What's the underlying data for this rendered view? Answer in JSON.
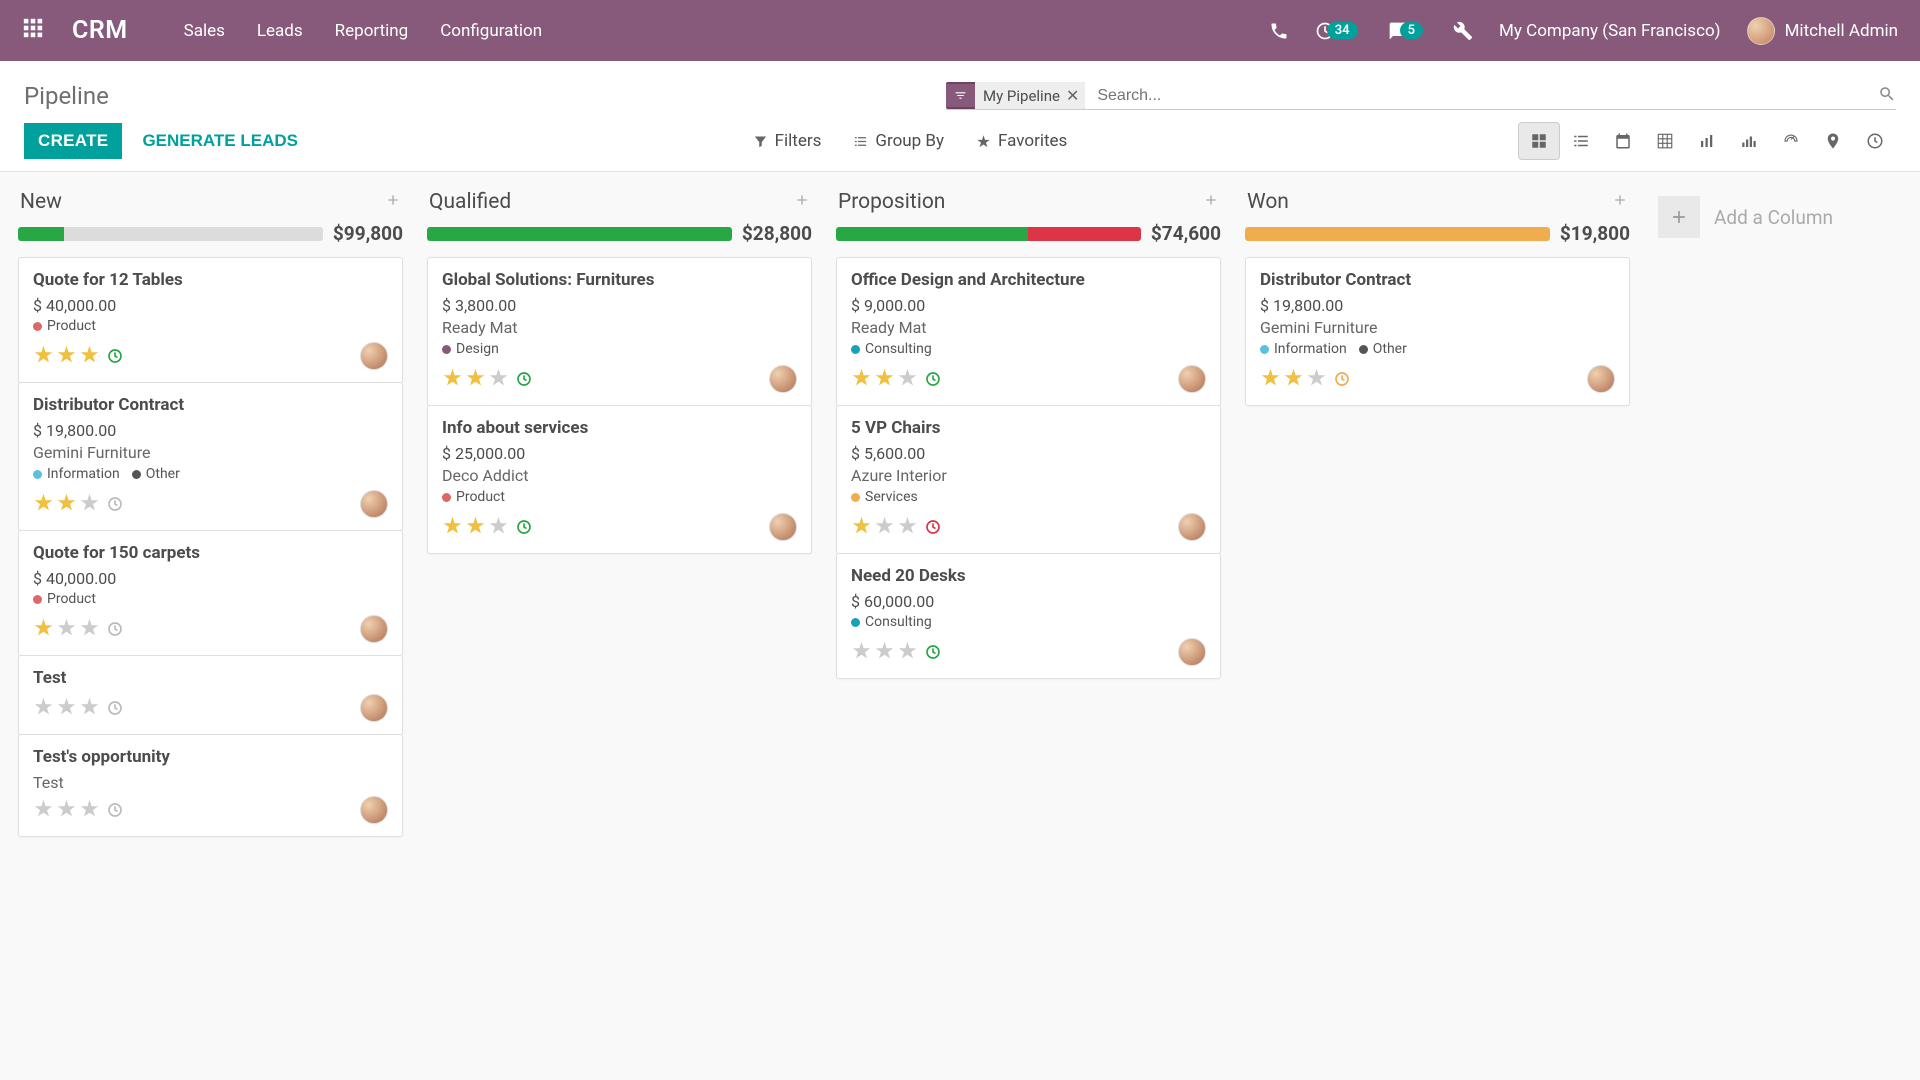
{
  "topbar": {
    "brand": "CRM",
    "nav": [
      "Sales",
      "Leads",
      "Reporting",
      "Configuration"
    ],
    "activity_count": "34",
    "msg_count": "5",
    "company": "My Company (San Francisco)",
    "user": "Mitchell Admin"
  },
  "control": {
    "title": "Pipeline",
    "create": "CREATE",
    "generate": "GENERATE LEADS",
    "facet_label": "My Pipeline",
    "search_placeholder": "Search...",
    "filters": "Filters",
    "group_by": "Group By",
    "favorites": "Favorites"
  },
  "colors": {
    "green": "#28a745",
    "red": "#dc3545",
    "orange": "#F0AD4E",
    "teal": "#17a2b8",
    "purple": "#875A7B",
    "blue": "#5bc0de",
    "grey": "#6c757d",
    "yellow": "#ffc107"
  },
  "tag_colors": {
    "Product": "#dc6965",
    "Information": "#5bc0de",
    "Other": "#555",
    "Design": "#875A7B",
    "Consulting": "#17a2b8",
    "Services": "#f0ad4e"
  },
  "add_column_label": "Add a Column",
  "columns": [
    {
      "title": "New",
      "amount": "$99,800",
      "progress": [
        [
          "green",
          15
        ]
      ],
      "cards": [
        {
          "title": "Quote for 12 Tables",
          "amount": "$ 40,000.00",
          "partner": "",
          "tags": [
            "Product"
          ],
          "stars": 3,
          "activity": "green"
        },
        {
          "title": "Distributor Contract",
          "amount": "$ 19,800.00",
          "partner": "Gemini Furniture",
          "tags": [
            "Information",
            "Other"
          ],
          "stars": 2,
          "activity": "grey"
        },
        {
          "title": "Quote for 150 carpets",
          "amount": "$ 40,000.00",
          "partner": "",
          "tags": [
            "Product"
          ],
          "stars": 1,
          "activity": "grey"
        },
        {
          "title": "Test",
          "amount": "",
          "partner": "",
          "tags": [],
          "stars": 0,
          "activity": "grey"
        },
        {
          "title": "Test's opportunity",
          "amount": "",
          "partner": "Test",
          "tags": [],
          "stars": 0,
          "activity": "grey"
        }
      ]
    },
    {
      "title": "Qualified",
      "amount": "$28,800",
      "progress": [
        [
          "green",
          100
        ]
      ],
      "cards": [
        {
          "title": "Global Solutions: Furnitures",
          "amount": "$ 3,800.00",
          "partner": "Ready Mat",
          "tags": [
            "Design"
          ],
          "stars": 2,
          "activity": "green"
        },
        {
          "title": "Info about services",
          "amount": "$ 25,000.00",
          "partner": "Deco Addict",
          "tags": [
            "Product"
          ],
          "stars": 2,
          "activity": "green"
        }
      ]
    },
    {
      "title": "Proposition",
      "amount": "$74,600",
      "progress": [
        [
          "green",
          63
        ],
        [
          "red",
          37
        ]
      ],
      "cards": [
        {
          "title": "Office Design and Architecture",
          "amount": "$ 9,000.00",
          "partner": "Ready Mat",
          "tags": [
            "Consulting"
          ],
          "stars": 2,
          "activity": "green"
        },
        {
          "title": "5 VP Chairs",
          "amount": "$ 5,600.00",
          "partner": "Azure Interior",
          "tags": [
            "Services"
          ],
          "stars": 1,
          "activity": "red"
        },
        {
          "title": "Need 20 Desks",
          "amount": "$ 60,000.00",
          "partner": "",
          "tags": [
            "Consulting"
          ],
          "stars": 0,
          "activity": "green"
        }
      ]
    },
    {
      "title": "Won",
      "amount": "$19,800",
      "progress": [
        [
          "orange",
          100
        ]
      ],
      "cards": [
        {
          "title": "Distributor Contract",
          "amount": "$ 19,800.00",
          "partner": "Gemini Furniture",
          "tags": [
            "Information",
            "Other"
          ],
          "stars": 2,
          "activity": "orange"
        }
      ]
    }
  ]
}
